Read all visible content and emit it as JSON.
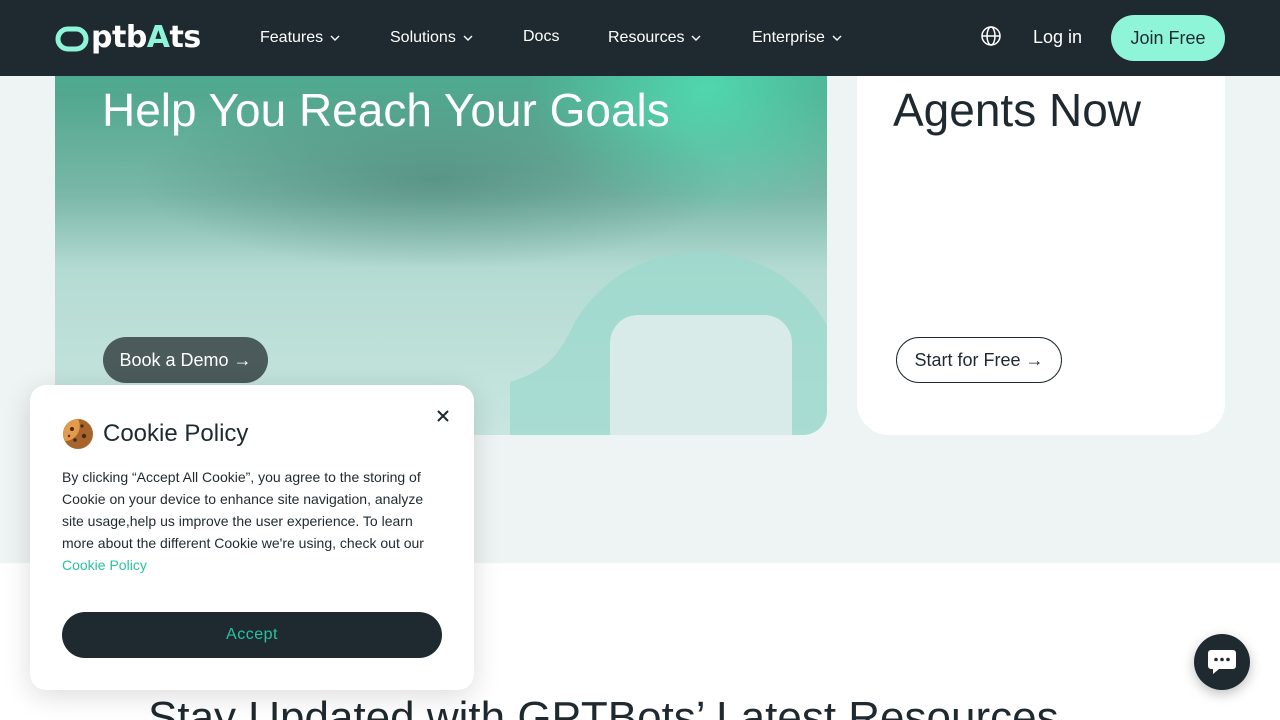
{
  "nav": {
    "logo": {
      "brand": "GPTBots",
      "display_prefix": "Ⓞptb",
      "display_accent": "A",
      "display_suffix": "ts"
    },
    "items": [
      {
        "label": "Features",
        "has_dropdown": true
      },
      {
        "label": "Solutions",
        "has_dropdown": true
      },
      {
        "label": "Docs",
        "has_dropdown": false
      },
      {
        "label": "Resources",
        "has_dropdown": true
      },
      {
        "label": "Enterprise",
        "has_dropdown": true
      }
    ],
    "globe_icon": "globe-icon",
    "login_label": "Log in",
    "join_label": "Join Free"
  },
  "hero_left": {
    "title": "Help You Reach Your Goals",
    "demo_button": "Book a Demo →"
  },
  "hero_right": {
    "title": "Agents Now",
    "start_button": "Start for Free →"
  },
  "lower": {
    "title": "Stay Updated with GPTBots’ Latest Resources"
  },
  "cookie": {
    "title": "Cookie Policy",
    "body": "By clicking “Accept All Cookie”, you agree to the storing of Cookie on your device to enhance site navigation, analyze site usage,help us improve the user experience. To learn more about the different Cookie we're using, check out our",
    "link": "Cookie Policy",
    "accept_label": "Accept",
    "cookie_icon": "cookie-icon",
    "close_icon": "close-icon"
  },
  "chat": {
    "icon": "chat-bubble-icon"
  },
  "colors": {
    "nav_bg": "#1f2a30",
    "accent_mint": "#8ff5d8",
    "link_teal": "#2bc1a0",
    "page_bg": "#eef4f3"
  }
}
